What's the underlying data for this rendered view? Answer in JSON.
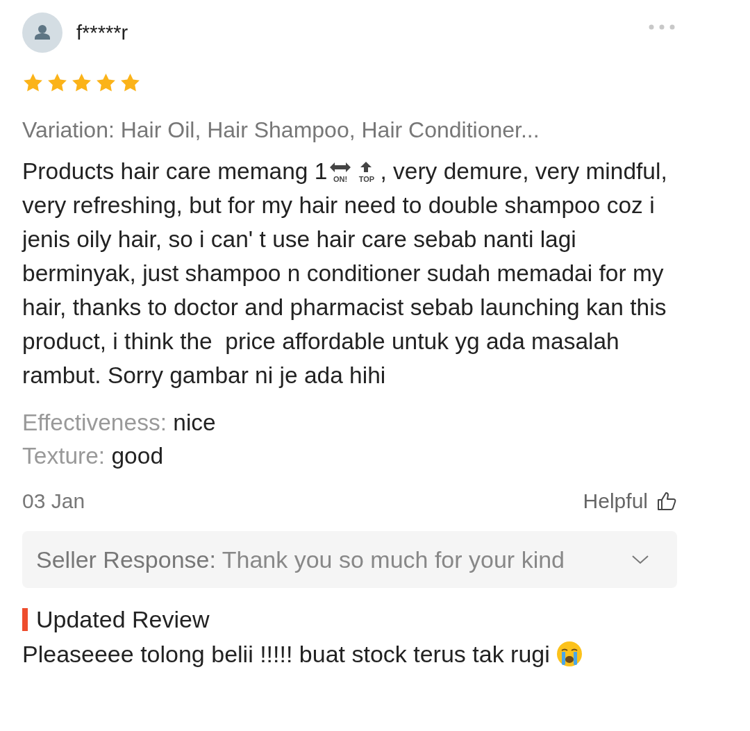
{
  "reviewer": {
    "name": "f*****r"
  },
  "stars": 5,
  "variation": "Variation: Hair Oil, Hair Shampoo, Hair Conditioner...",
  "body": {
    "before": "Products hair care memang 1",
    "emoji": [
      {
        "kind": "on",
        "label": "ON!"
      },
      {
        "kind": "top",
        "label": "TOP"
      }
    ],
    "after": ", very demure, very mindful, very refreshing, but for my hair need to double shampoo coz i jenis oily hair, so i can' t use hair care sebab nanti lagi berminyak, just shampoo n conditioner sudah memadai for my hair, thanks to doctor and pharmacist sebab launching kan this product, i think the  price affordable untuk yg ada masalah rambut. Sorry gambar ni je ada hihi"
  },
  "attributes": [
    {
      "label": "Effectiveness:",
      "value": "nice"
    },
    {
      "label": "Texture:",
      "value": "good"
    }
  ],
  "date": "03 Jan",
  "helpful": "Helpful",
  "seller_response": {
    "label": "Seller Response:",
    "text": "Thank you so much for your kind",
    "expanded": false
  },
  "updated_review": {
    "title": "Updated Review",
    "text": "Pleaseeee tolong belii !!!!! buat stock terus tak rugi"
  }
}
